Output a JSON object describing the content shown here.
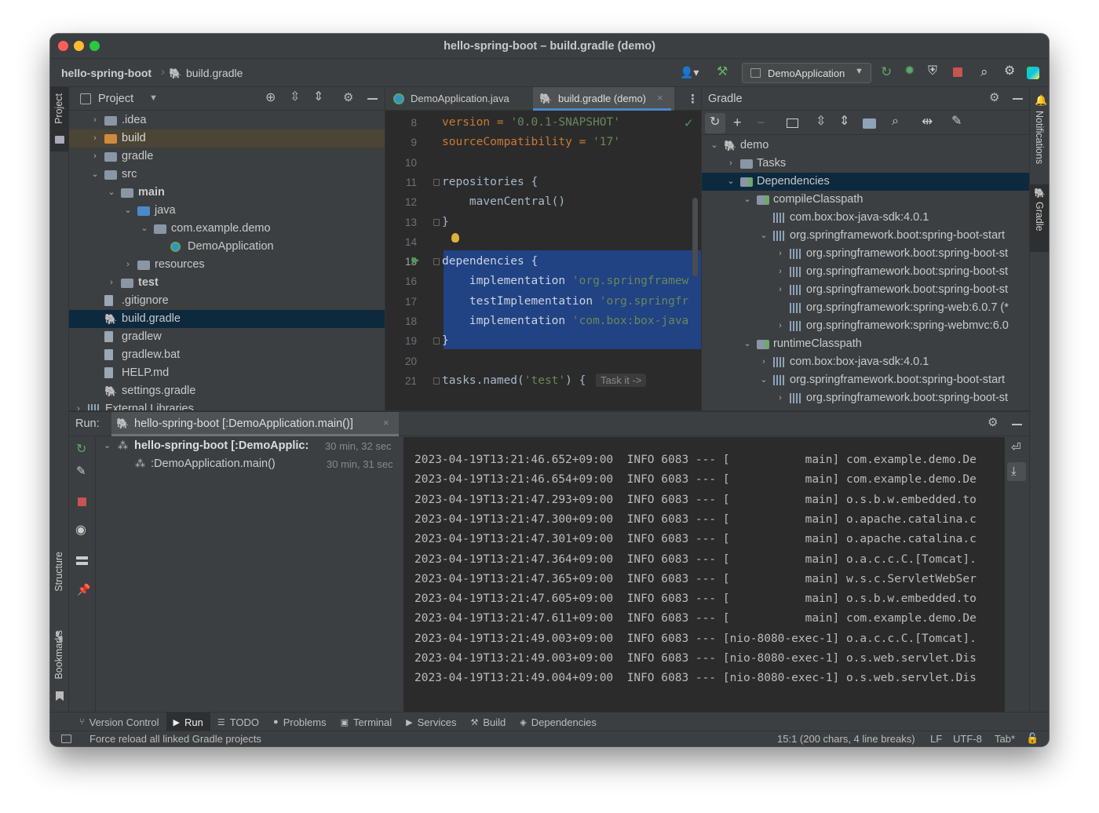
{
  "window": {
    "title": "hello-spring-boot – build.gradle (demo)"
  },
  "nav": {
    "project": "hello-spring-boot",
    "file": "build.gradle",
    "run_config": "DemoApplication"
  },
  "project_pane": {
    "title": "Project",
    "stripe_label": "Project",
    "items": [
      {
        "label": ".idea",
        "indent": 0,
        "chevron": "›",
        "type": "folder"
      },
      {
        "label": "build",
        "indent": 0,
        "chevron": "›",
        "type": "folder-orange"
      },
      {
        "label": "gradle",
        "indent": 0,
        "chevron": "›",
        "type": "folder"
      },
      {
        "label": "src",
        "indent": 0,
        "chevron": "⌄",
        "type": "folder"
      },
      {
        "label": "main",
        "indent": 1,
        "chevron": "⌄",
        "type": "folder-module",
        "bold": true
      },
      {
        "label": "java",
        "indent": 2,
        "chevron": "⌄",
        "type": "folder-blue"
      },
      {
        "label": "com.example.demo",
        "indent": 3,
        "chevron": "⌄",
        "type": "package"
      },
      {
        "label": "DemoApplication",
        "indent": 4,
        "chevron": "",
        "type": "class"
      },
      {
        "label": "resources",
        "indent": 2,
        "chevron": "›",
        "type": "folder-res"
      },
      {
        "label": "test",
        "indent": 1,
        "chevron": "›",
        "type": "folder-module",
        "bold": true
      },
      {
        "label": ".gitignore",
        "indent": 0,
        "chevron": "",
        "type": "file-ignore"
      },
      {
        "label": "build.gradle",
        "indent": 0,
        "chevron": "",
        "type": "gradle",
        "selected": true
      },
      {
        "label": "gradlew",
        "indent": 0,
        "chevron": "",
        "type": "file-exec"
      },
      {
        "label": "gradlew.bat",
        "indent": 0,
        "chevron": "",
        "type": "file-text"
      },
      {
        "label": "HELP.md",
        "indent": 0,
        "chevron": "",
        "type": "file-md"
      },
      {
        "label": "settings.gradle",
        "indent": 0,
        "chevron": "",
        "type": "gradle"
      },
      {
        "label": "External Libraries",
        "indent": -1,
        "chevron": "›",
        "type": "libs"
      }
    ]
  },
  "editor": {
    "tabs": [
      {
        "label": "DemoApplication.java",
        "active": false
      },
      {
        "label": "build.gradle (demo)",
        "active": true
      }
    ],
    "lines": [
      {
        "n": "8",
        "parts": [
          {
            "t": "version = ",
            "c": "kw"
          },
          {
            "t": "'0.0.1-SNAPSHOT'",
            "c": "str"
          }
        ]
      },
      {
        "n": "9",
        "parts": [
          {
            "t": "sourceCompatibility = ",
            "c": "kw"
          },
          {
            "t": "'17'",
            "c": "str"
          }
        ]
      },
      {
        "n": "10",
        "parts": []
      },
      {
        "n": "11",
        "parts": [
          {
            "t": "repositories {",
            "c": "pl"
          }
        ]
      },
      {
        "n": "12",
        "parts": [
          {
            "t": "    mavenCentral()",
            "c": "pl"
          }
        ]
      },
      {
        "n": "13",
        "parts": [
          {
            "t": "}",
            "c": "pl"
          }
        ]
      },
      {
        "n": "14",
        "parts": []
      },
      {
        "n": "15",
        "parts": [
          {
            "t": "dependencies {",
            "c": "pl"
          }
        ]
      },
      {
        "n": "16",
        "parts": [
          {
            "t": "    implementation ",
            "c": "pl"
          },
          {
            "t": "'org.springframew",
            "c": "str"
          }
        ]
      },
      {
        "n": "17",
        "parts": [
          {
            "t": "    testImplementation ",
            "c": "pl"
          },
          {
            "t": "'org.springfr",
            "c": "str"
          }
        ]
      },
      {
        "n": "18",
        "parts": [
          {
            "t": "    implementation ",
            "c": "pl"
          },
          {
            "t": "'com.box:box-java",
            "c": "str"
          }
        ]
      },
      {
        "n": "19",
        "parts": [
          {
            "t": "}",
            "c": "pl"
          }
        ]
      },
      {
        "n": "20",
        "parts": []
      },
      {
        "n": "21",
        "parts": [
          {
            "t": "tasks.named(",
            "c": "pl"
          },
          {
            "t": "'test'",
            "c": "str"
          },
          {
            "t": ") {",
            "c": "pl"
          }
        ]
      }
    ],
    "inlay": "Task it ->"
  },
  "gradle_pane": {
    "title": "Gradle",
    "stripe_notifications": "Notifications",
    "stripe_gradle": "Gradle",
    "items": [
      {
        "label": "demo",
        "indent": 0,
        "chevron": "⌄",
        "icon": "gradle"
      },
      {
        "label": "Tasks",
        "indent": 1,
        "chevron": "›",
        "icon": "folder-gear"
      },
      {
        "label": "Dependencies",
        "indent": 1,
        "chevron": "⌄",
        "icon": "folder-bars",
        "selected": true
      },
      {
        "label": "compileClasspath",
        "indent": 2,
        "chevron": "⌄",
        "icon": "folder-bars"
      },
      {
        "label": "com.box:box-java-sdk:4.0.1",
        "indent": 3,
        "chevron": "",
        "icon": "bars"
      },
      {
        "label": "org.springframework.boot:spring-boot-start",
        "indent": 3,
        "chevron": "⌄",
        "icon": "bars"
      },
      {
        "label": "org.springframework.boot:spring-boot-st",
        "indent": 4,
        "chevron": "›",
        "icon": "bars"
      },
      {
        "label": "org.springframework.boot:spring-boot-st",
        "indent": 4,
        "chevron": "›",
        "icon": "bars"
      },
      {
        "label": "org.springframework.boot:spring-boot-st",
        "indent": 4,
        "chevron": "›",
        "icon": "bars"
      },
      {
        "label": "org.springframework:spring-web:6.0.7 (*",
        "indent": 4,
        "chevron": "",
        "icon": "bars"
      },
      {
        "label": "org.springframework:spring-webmvc:6.0",
        "indent": 4,
        "chevron": "›",
        "icon": "bars"
      },
      {
        "label": "runtimeClasspath",
        "indent": 2,
        "chevron": "⌄",
        "icon": "folder-bars"
      },
      {
        "label": "com.box:box-java-sdk:4.0.1",
        "indent": 3,
        "chevron": "›",
        "icon": "bars"
      },
      {
        "label": "org.springframework.boot:spring-boot-start",
        "indent": 3,
        "chevron": "⌄",
        "icon": "bars"
      },
      {
        "label": "org.springframework.boot:spring-boot-st",
        "indent": 4,
        "chevron": "›",
        "icon": "bars"
      }
    ]
  },
  "run": {
    "label": "Run:",
    "tab": "hello-spring-boot [:DemoApplication.main()]",
    "tree": [
      {
        "label": "hello-spring-boot [:DemoApplic:",
        "time": "30 min, 32 sec",
        "bold": true
      },
      {
        "label": ":DemoApplication.main()",
        "time": "30 min, 31 sec",
        "bold": false
      }
    ],
    "console": [
      "2023-04-19T13:21:46.652+09:00  INFO 6083 --- [           main] com.example.demo.De",
      "2023-04-19T13:21:46.654+09:00  INFO 6083 --- [           main] com.example.demo.De",
      "2023-04-19T13:21:47.293+09:00  INFO 6083 --- [           main] o.s.b.w.embedded.to",
      "2023-04-19T13:21:47.300+09:00  INFO 6083 --- [           main] o.apache.catalina.c",
      "2023-04-19T13:21:47.301+09:00  INFO 6083 --- [           main] o.apache.catalina.c",
      "2023-04-19T13:21:47.364+09:00  INFO 6083 --- [           main] o.a.c.c.C.[Tomcat].",
      "2023-04-19T13:21:47.365+09:00  INFO 6083 --- [           main] w.s.c.ServletWebSer",
      "2023-04-19T13:21:47.605+09:00  INFO 6083 --- [           main] o.s.b.w.embedded.to",
      "2023-04-19T13:21:47.611+09:00  INFO 6083 --- [           main] com.example.demo.De",
      "2023-04-19T13:21:49.003+09:00  INFO 6083 --- [nio-8080-exec-1] o.a.c.c.C.[Tomcat].",
      "2023-04-19T13:21:49.003+09:00  INFO 6083 --- [nio-8080-exec-1] o.s.web.servlet.Dis",
      "2023-04-19T13:21:49.004+09:00  INFO 6083 --- [nio-8080-exec-1] o.s.web.servlet.Dis"
    ],
    "stripe_structure": "Structure",
    "stripe_bookmarks": "Bookmarks"
  },
  "bottom_tabs": [
    {
      "label": "Version Control",
      "icon": "vcs-icon",
      "glyph": "⑂"
    },
    {
      "label": "Run",
      "icon": "run-icon",
      "glyph": "▶",
      "active": true
    },
    {
      "label": "TODO",
      "icon": "todo-icon",
      "glyph": "☰"
    },
    {
      "label": "Problems",
      "icon": "problems-icon",
      "glyph": "●"
    },
    {
      "label": "Terminal",
      "icon": "terminal-icon",
      "glyph": "▣"
    },
    {
      "label": "Services",
      "icon": "services-icon",
      "glyph": "▶"
    },
    {
      "label": "Build",
      "icon": "hammer-icon",
      "glyph": "⚒"
    },
    {
      "label": "Dependencies",
      "icon": "dependencies-icon",
      "glyph": "◈"
    }
  ],
  "status": {
    "message": "Force reload all linked Gradle projects",
    "position": "15:1 (200 chars, 4 line breaks)",
    "line_sep": "LF",
    "encoding": "UTF-8",
    "indent": "Tab*"
  },
  "colors": {
    "background": "#2b2b2b",
    "panel": "#3c3f41",
    "selection": "#0d293e",
    "editor_selection": "#214283",
    "accent_green": "#499c54",
    "accent_red": "#c75450",
    "accent_blue": "#3592c4"
  }
}
